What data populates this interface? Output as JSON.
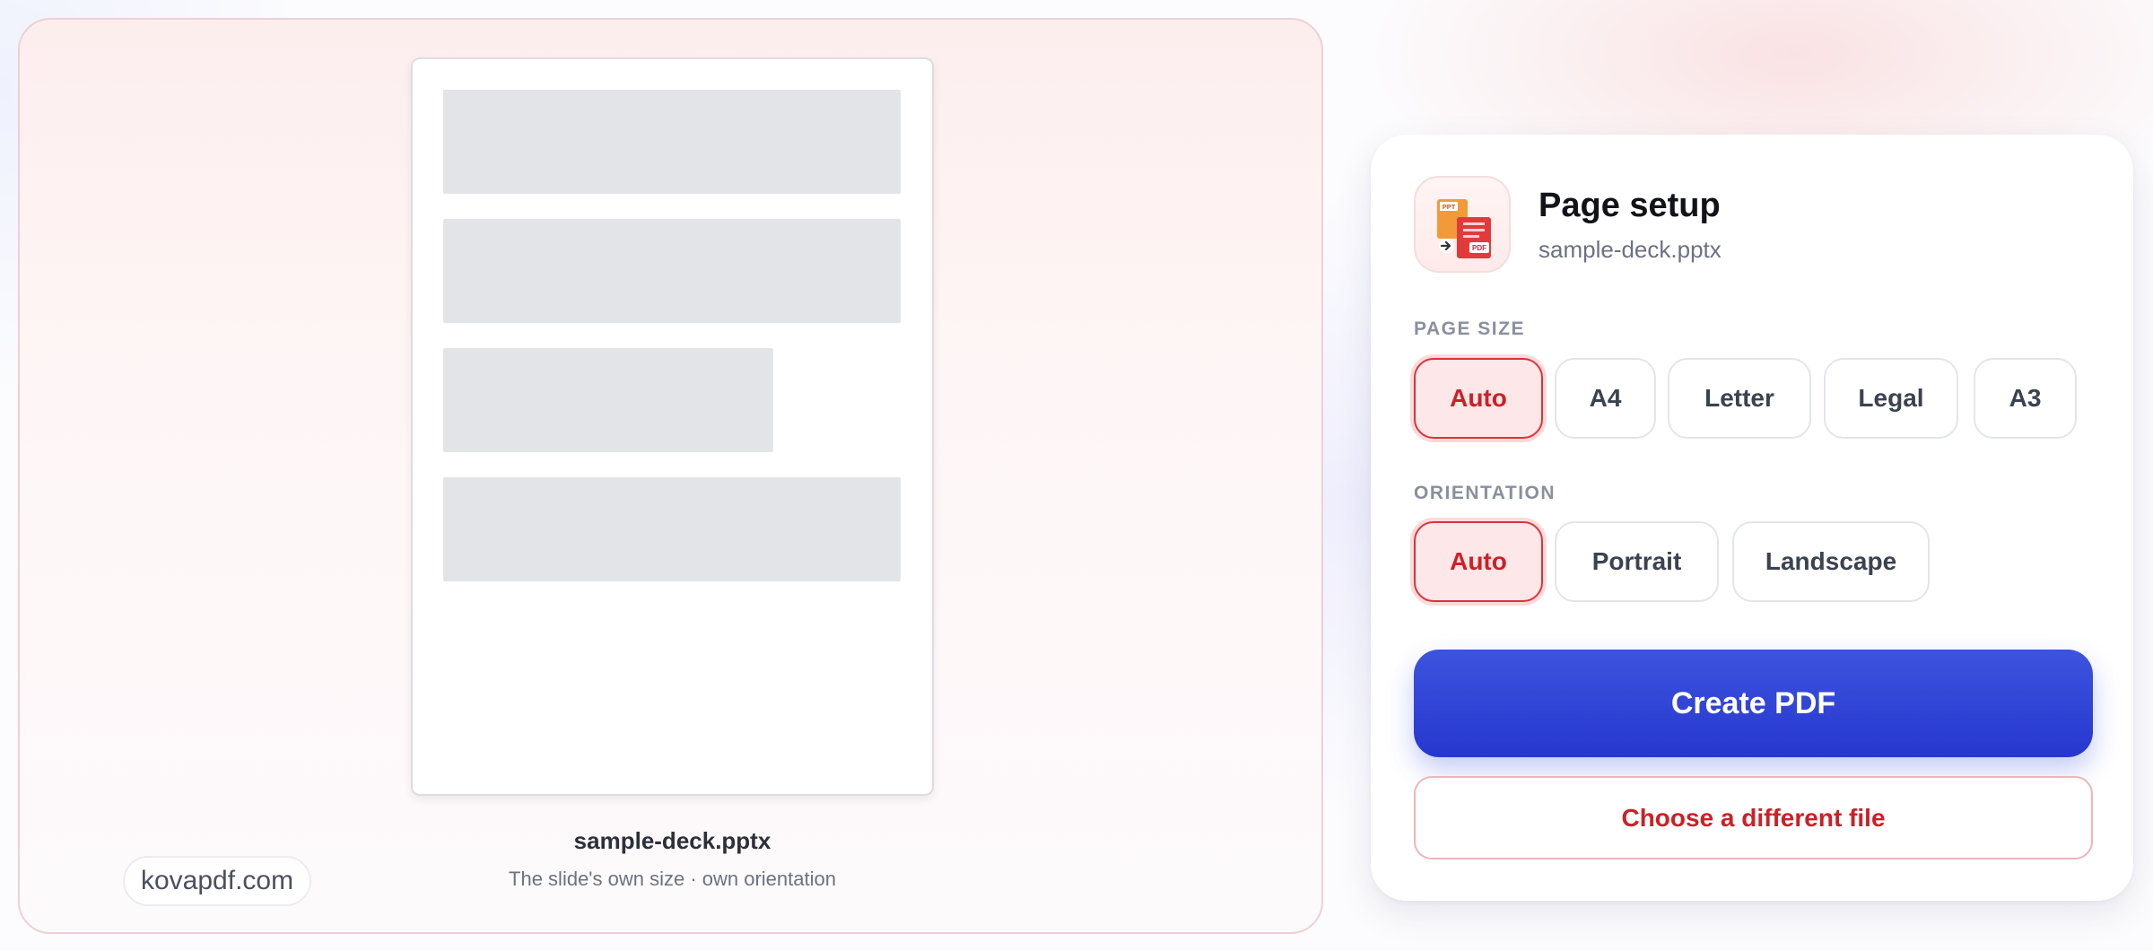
{
  "preview": {
    "file_name": "sample-deck.pptx",
    "meta": "The slide's own size · own orientation",
    "brand": "kovapdf.com"
  },
  "setup": {
    "title": "Page setup",
    "subtitle": "sample-deck.pptx",
    "icon": {
      "name": "ppt-to-pdf-icon",
      "badges": [
        "PPT",
        "PDF"
      ]
    },
    "page_size": {
      "label": "PAGE SIZE",
      "options": [
        "Auto",
        "A4",
        "Letter",
        "Legal",
        "A3"
      ],
      "selected": "Auto"
    },
    "orientation": {
      "label": "ORIENTATION",
      "options": [
        "Auto",
        "Portrait",
        "Landscape"
      ],
      "selected": "Auto"
    },
    "create_label": "Create PDF",
    "choose_label": "Choose a different file"
  },
  "colors": {
    "accent_red": "#cc2027",
    "selected_bg": "#fde7e8",
    "primary_blue": "#2f44d8"
  }
}
